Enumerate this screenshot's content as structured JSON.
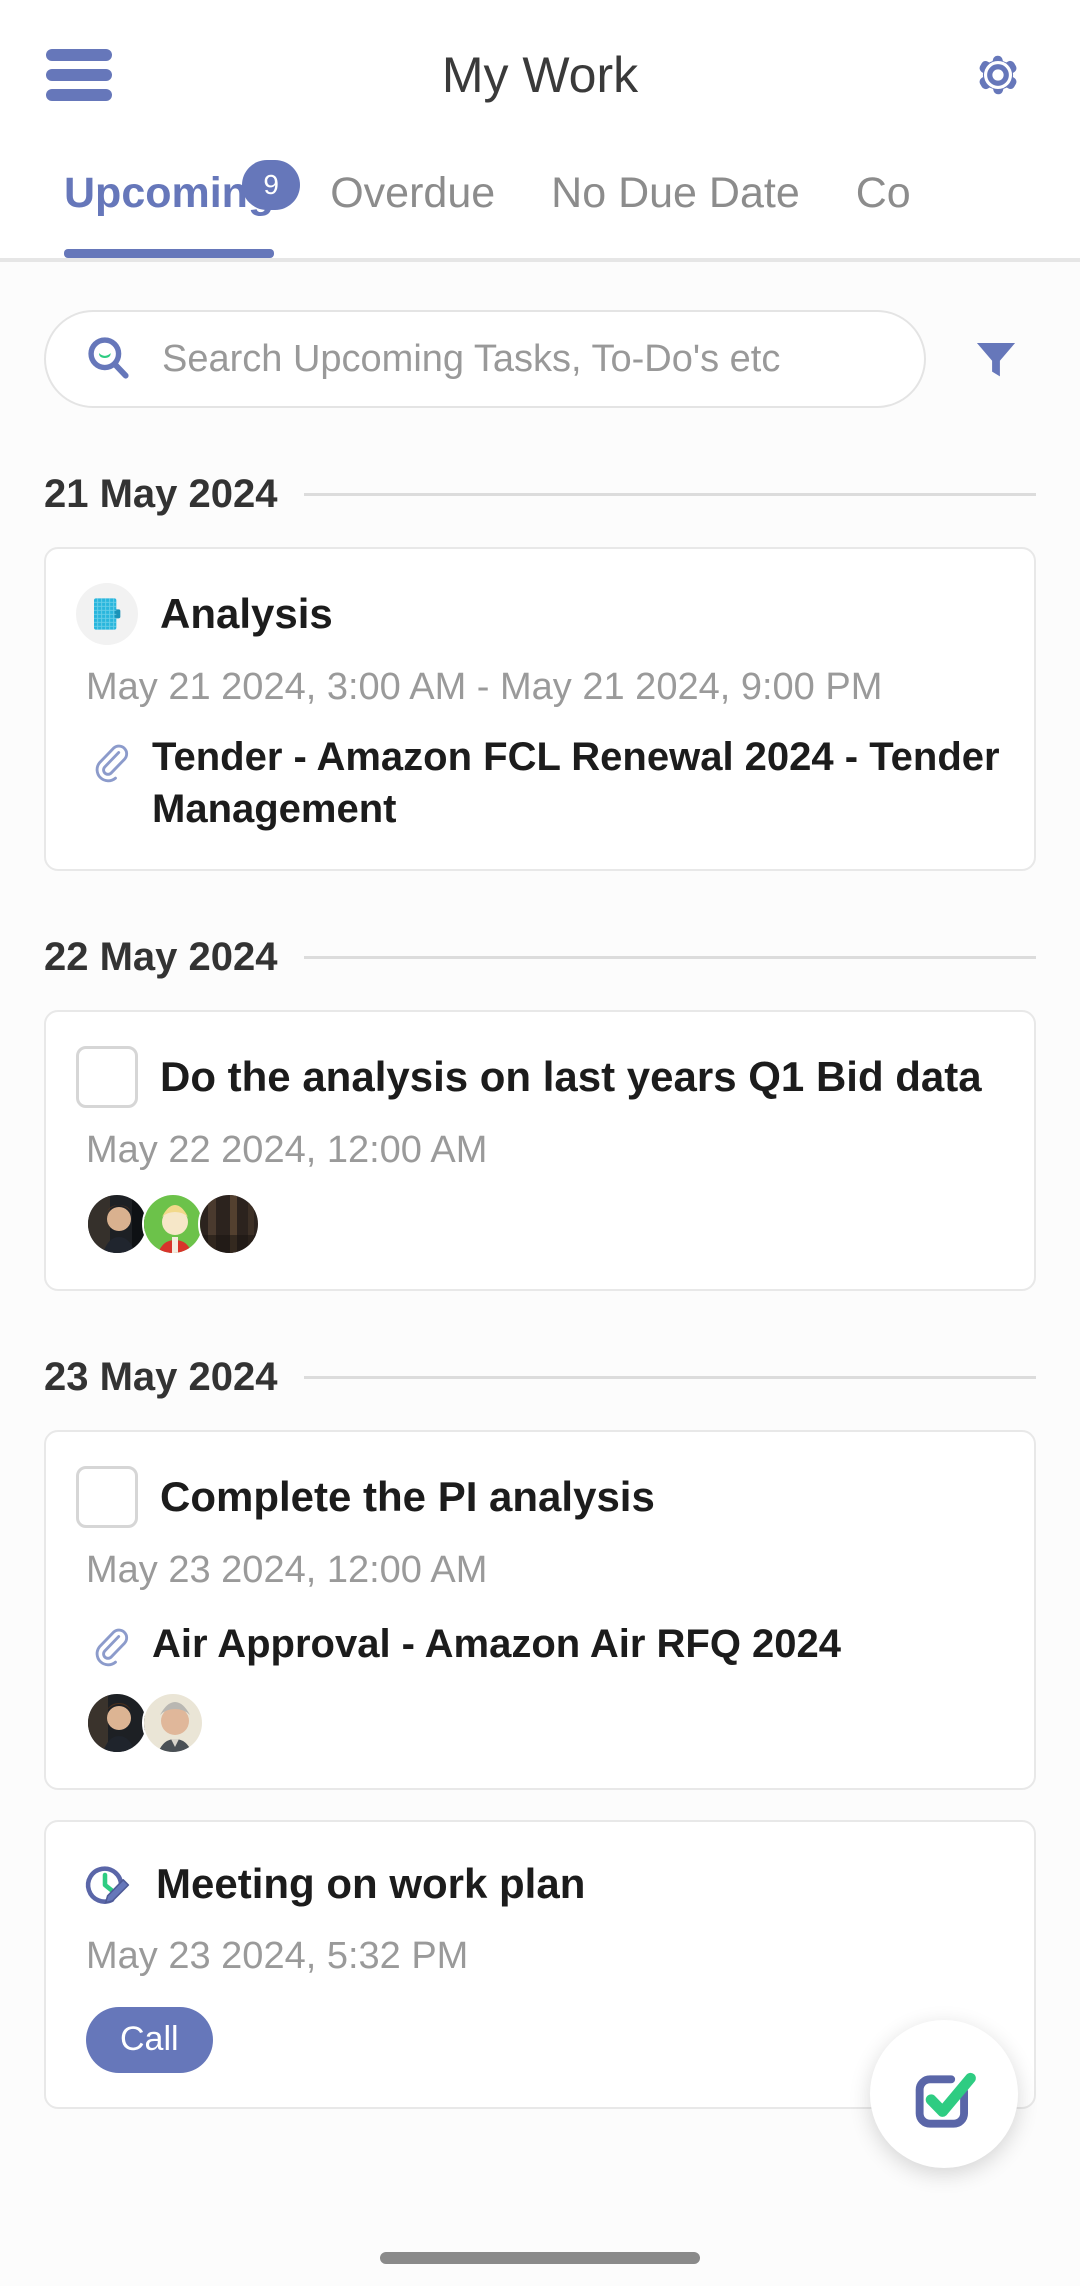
{
  "header": {
    "title": "My Work",
    "menu_icon": "hamburger-menu-icon",
    "settings_icon": "gear-icon"
  },
  "tabs": [
    {
      "label": "Upcoming",
      "badge": "9",
      "active": true
    },
    {
      "label": "Overdue",
      "badge": null,
      "active": false
    },
    {
      "label": "No Due Date",
      "badge": null,
      "active": false
    },
    {
      "label": "Co",
      "badge": null,
      "active": false
    }
  ],
  "search": {
    "placeholder": "Search Upcoming Tasks, To-Do's etc",
    "value": "",
    "icon": "search-icon",
    "filter_icon": "filter-funnel-icon"
  },
  "groups": [
    {
      "date": "21 May 2024",
      "items": [
        {
          "kind": "event",
          "icon": "notebook-icon",
          "title": "Analysis",
          "time": "May 21 2024, 3:00 AM - May 21 2024, 9:00 PM",
          "link": "Tender - Amazon FCL Renewal 2024 - Tender Management",
          "avatars": [],
          "pill": null
        }
      ]
    },
    {
      "date": "22 May 2024",
      "items": [
        {
          "kind": "todo",
          "icon": "checkbox-unchecked",
          "title": "Do the analysis on last years Q1 Bid data",
          "time": "May 22 2024, 12:00 AM",
          "link": null,
          "avatars": [
            "avatar-dark-photo",
            "avatar-green-cartoon",
            "avatar-brown-photo"
          ],
          "pill": null
        }
      ]
    },
    {
      "date": "23 May 2024",
      "items": [
        {
          "kind": "todo",
          "icon": "checkbox-unchecked",
          "title": "Complete the PI analysis",
          "time": "May 23 2024, 12:00 AM",
          "link": "Air Approval - Amazon Air RFQ 2024",
          "avatars": [
            "avatar-dark-photo",
            "avatar-grey-hair-photo"
          ],
          "pill": null
        },
        {
          "kind": "activity",
          "icon": "clock-pencil-icon",
          "title": "Meeting on work plan",
          "time": "May 23 2024, 5:32 PM",
          "link": null,
          "avatars": [],
          "pill": "Call"
        }
      ]
    }
  ],
  "fab": {
    "icon": "checkbox-check-icon",
    "label": ""
  },
  "colors": {
    "accent": "#6677ba",
    "accent_green": "#2ecc82",
    "icon_cyan": "#29b6dd",
    "text_primary": "#1c1c1c",
    "text_muted": "#9a9a9a",
    "tab_inactive": "#8c8c8c",
    "card_border": "#e8e8e8",
    "page_bg": "#fcfcfc"
  }
}
